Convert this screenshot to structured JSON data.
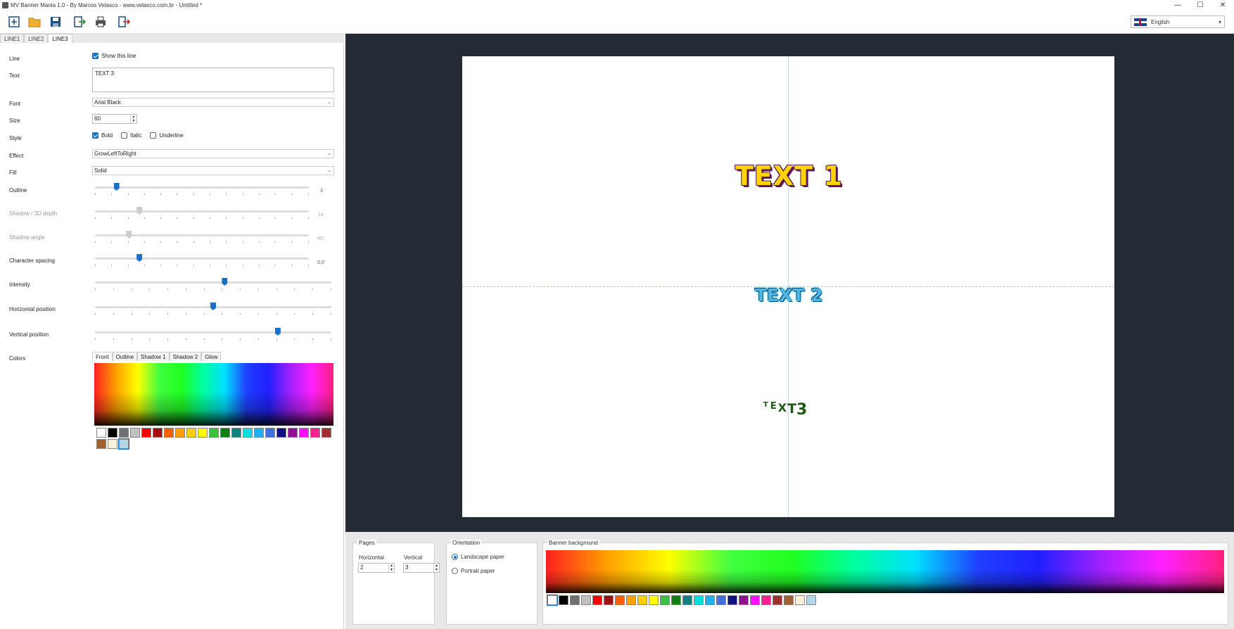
{
  "window": {
    "title": "MV Banner Mania 1.0 - By Marcos Velasco - www.velasco.com.br - Untitled *",
    "controls": [
      "—",
      "☐",
      "✕"
    ]
  },
  "toolbar": {
    "language": "English"
  },
  "line_tabs": [
    "LINE1",
    "LINE2",
    "LINE3"
  ],
  "props": {
    "line_label": "Line",
    "show_line": "Show this line",
    "text_label": "Text",
    "text_value": "TEXT 3",
    "font_label": "Font",
    "font_value": "Arial Black",
    "size_label": "Size",
    "size_value": "60",
    "style_label": "Style",
    "bold": "Bold",
    "italic": "Italic",
    "underline": "Underline",
    "effect_label": "Effect",
    "effect_value": "GrowLeftToRight",
    "fill_label": "Fill",
    "fill_value": "Solid",
    "outline_label": "Outline",
    "outline_value": "3",
    "shadow_label": "Shadow / 3D depth",
    "shadow_value": "14",
    "shadow_angle_label": "Shadow angle",
    "shadow_angle_value": "45°",
    "spacing_label": "Character spacing",
    "spacing_value": "0,0",
    "intensity_label": "Intensity",
    "hpos_label": "Horizontal position",
    "vpos_label": "Vertical position",
    "colors_label": "Colors"
  },
  "sliders": {
    "outline": 0.09,
    "shadow": 0.2,
    "shadow_angle": 0.15,
    "spacing": 0.2,
    "intensity": 0.55,
    "hpos": 0.5,
    "vpos": 0.78
  },
  "color_tabs": [
    "Front",
    "Outline",
    "Shadow 1",
    "Shadow 2",
    "Glow"
  ],
  "palette": [
    "#ffffff",
    "#000000",
    "#707070",
    "#c0c0c0",
    "#ff0000",
    "#a01010",
    "#ff6000",
    "#ffa000",
    "#ffd000",
    "#ffff00",
    "#40c040",
    "#108010",
    "#108080",
    "#00e0e0",
    "#20b0f0",
    "#4070e0",
    "#101080",
    "#901090",
    "#ff10ff",
    "#ff2090",
    "#a03030",
    "#a06030",
    "#f8f0d8",
    "#b0d8e8"
  ],
  "banner": {
    "line1": "TEXT 1",
    "line2": "TEXT 2",
    "line3": [
      "T",
      "E",
      "X",
      "T",
      "3"
    ]
  },
  "bottom": {
    "pages_title": "Pages",
    "horizontal_label": "Horizontal",
    "vertical_label": "Vertical",
    "horizontal_value": "2",
    "vertical_value": "3",
    "orientation_title": "Orientation",
    "landscape": "Landscape paper",
    "portrait": "Portrait paper",
    "background_title": "Banner background"
  }
}
